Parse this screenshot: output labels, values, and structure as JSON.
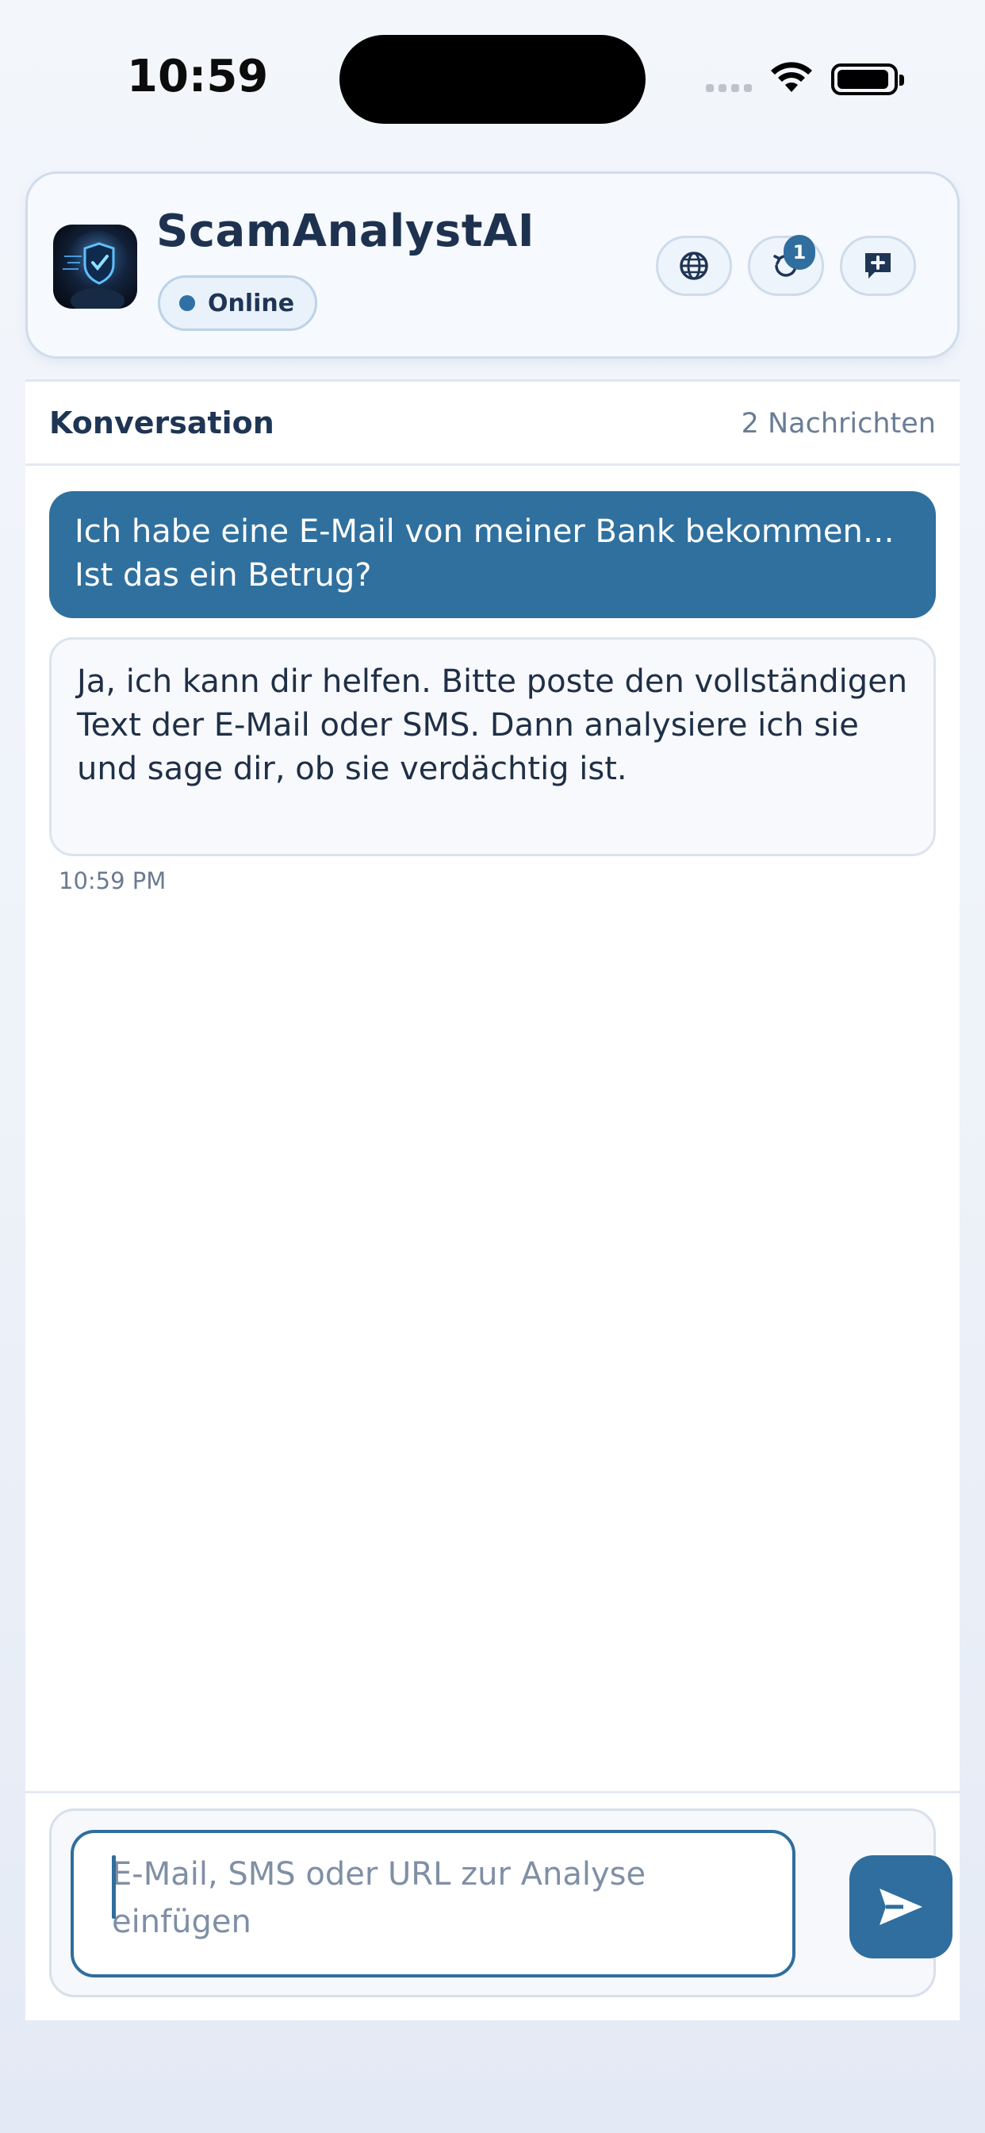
{
  "status_bar": {
    "time": "10:59"
  },
  "header": {
    "app_name": "ScamAnalystAI",
    "status_label": "Online",
    "history_badge": "1",
    "icons": [
      "globe-icon",
      "history-icon",
      "new-chat-icon"
    ]
  },
  "conversation": {
    "title": "Konversation",
    "message_count": "2 Nachrichten",
    "messages": [
      {
        "role": "user",
        "text": "Ich habe eine E-Mail von meiner Bank bekommen… Ist das ein Betrug?"
      },
      {
        "role": "assistant",
        "text": "Ja, ich kann dir helfen. Bitte poste den vollständigen Text der E-Mail oder SMS. Dann analysiere ich sie und sage dir, ob sie verdächtig ist.",
        "time": "10:59 PM"
      }
    ]
  },
  "composer": {
    "placeholder": "E-Mail, SMS oder URL zur Analyse einfügen",
    "send_icon": "send-icon"
  },
  "colors": {
    "accent": "#2f6e9e",
    "user_bubble": "#2f709e",
    "assistant_bubble": "#f7f9fc",
    "text_dark": "#1f3555",
    "text_muted": "#6a7d96"
  }
}
